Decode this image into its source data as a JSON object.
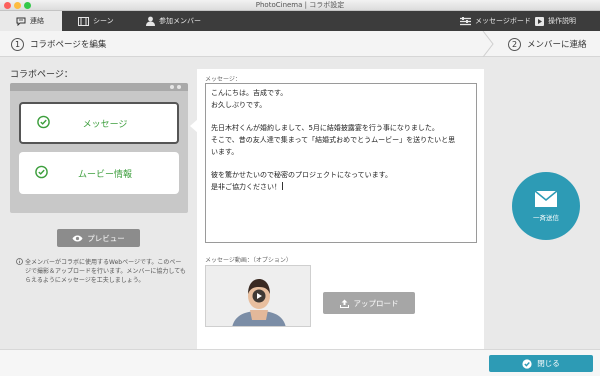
{
  "window": {
    "title": "PhotoCinema | コラボ設定"
  },
  "tabs": [
    {
      "label": "連絡",
      "icon": "chat-icon",
      "active": true
    },
    {
      "label": "シーン",
      "icon": "film-icon",
      "active": false
    },
    {
      "label": "参加メンバー",
      "icon": "person-icon",
      "active": false
    }
  ],
  "toolbar": {
    "message_board": {
      "label": "メッセージボード",
      "icon": "board-icon"
    },
    "manual": {
      "label": "操作説明",
      "icon": "play-icon"
    }
  },
  "steps": [
    {
      "num": "1",
      "label": "コラボページを編集"
    },
    {
      "num": "2",
      "label": "メンバーに連絡"
    }
  ],
  "left": {
    "title": "コラボページ：",
    "cards": [
      {
        "label": "メッセージ",
        "selected": true
      },
      {
        "label": "ムービー情報",
        "selected": false
      }
    ],
    "preview_label": "プレビュー",
    "note": "全メンバーがコラボに使用するWebページです。このページで撮影＆アップロードを行います。メンバーに協力してもらえるようにメッセージを工夫しましょう。"
  },
  "message": {
    "label": "メッセージ：",
    "lines": [
      "こんにちは。吉成です。",
      "お久しぶりです。",
      "",
      "先日木村くんが婚約しまして、5月に結婚披露宴を行う事になりました。",
      "そこで、昔の友人達で集まって「結婚式おめでとうムービー」を送りたいと思",
      "います。",
      "",
      "彼を驚かせたいので秘密のプロジェクトになっています。",
      "是非ご協力ください！"
    ]
  },
  "video": {
    "label": "メッセージ動画：（オプション）",
    "upload_label": "アップロード"
  },
  "send": {
    "label": "一斉送信"
  },
  "close": {
    "label": "閉じる"
  },
  "colors": {
    "accent": "#2d9bb5",
    "check": "#3c9e3c",
    "tabbar": "#3c3c3c"
  }
}
